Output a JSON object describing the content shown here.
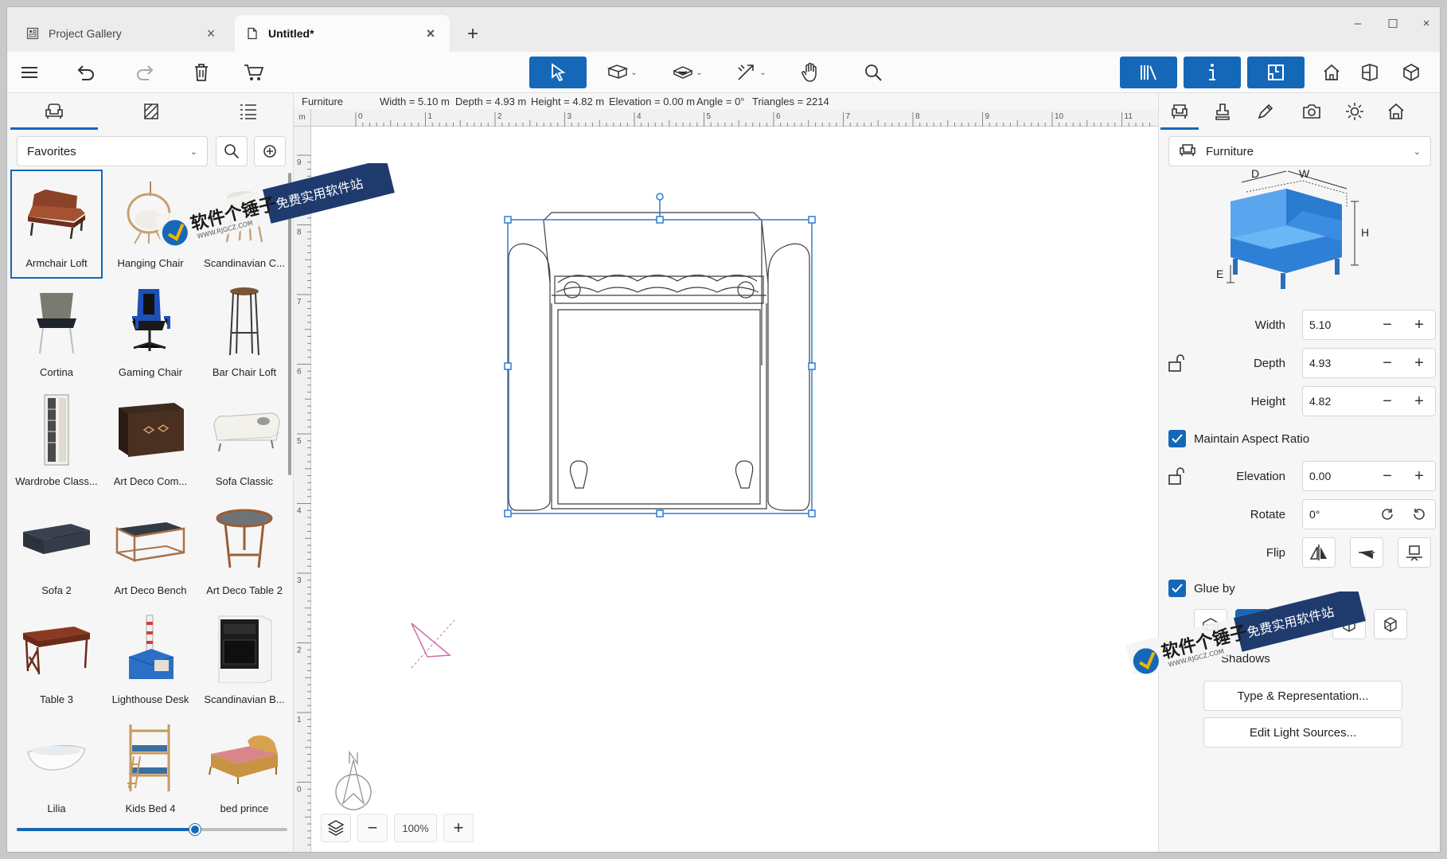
{
  "tabs": [
    {
      "label": "Project Gallery",
      "close": "×"
    },
    {
      "label": "Untitled*",
      "close": "×"
    }
  ],
  "tab_add": "+",
  "window_controls": {
    "minimize": "–",
    "maximize": "☐",
    "close": "×"
  },
  "toolbar": {
    "menu_icon": "hamburger-menu-icon",
    "undo_icon": "undo-icon",
    "redo_icon": "redo-icon",
    "delete_icon": "trash-icon",
    "cart_icon": "cart-icon",
    "select_icon": "pointer-icon",
    "search_icon": "search-icon",
    "accent_color": "#1568b8"
  },
  "left_panel": {
    "tabs": [
      "furniture-icon",
      "materials-icon",
      "list-icon"
    ],
    "filter": {
      "selected": "Favorites"
    },
    "items": [
      {
        "name": "Armchair Loft"
      },
      {
        "name": "Hanging Chair"
      },
      {
        "name": "Scandinavian C..."
      },
      {
        "name": "Cortina"
      },
      {
        "name": "Gaming Chair"
      },
      {
        "name": "Bar Chair Loft"
      },
      {
        "name": "Wardrobe Class..."
      },
      {
        "name": "Art Deco Com..."
      },
      {
        "name": "Sofa Classic"
      },
      {
        "name": "Sofa 2"
      },
      {
        "name": "Art Deco Bench"
      },
      {
        "name": "Art Deco Table 2"
      },
      {
        "name": "Table 3"
      },
      {
        "name": "Lighthouse Desk"
      },
      {
        "name": "Scandinavian B..."
      },
      {
        "name": "Lilia"
      },
      {
        "name": "Kids Bed 4"
      },
      {
        "name": "bed prince"
      }
    ],
    "thumbnail_size_fraction": 0.66
  },
  "infobar": {
    "category": "Furniture",
    "width": "Width = 5.10 m",
    "depth": "Depth = 4.93 m",
    "height": "Height = 4.82 m",
    "elevation": "Elevation = 0.00 m",
    "angle": "Angle = 0°",
    "triangles": "Triangles = 2214"
  },
  "ruler": {
    "unit": "m",
    "top_ticks": [
      "0",
      "1",
      "2",
      "3",
      "4",
      "5",
      "6",
      "7",
      "8",
      "9",
      "10",
      "11"
    ],
    "left_ticks": [
      "9",
      "8",
      "7",
      "6",
      "5",
      "4",
      "3",
      "2",
      "1",
      "0"
    ]
  },
  "zoom": {
    "value": "100%",
    "minus": "−",
    "plus": "+"
  },
  "right_panel": {
    "category": "Furniture",
    "dim_labels": {
      "d": "D",
      "w": "W",
      "h": "H",
      "e": "E"
    },
    "width": {
      "label": "Width",
      "value": "5.10"
    },
    "depth": {
      "label": "Depth",
      "value": "4.93"
    },
    "height": {
      "label": "Height",
      "value": "4.82"
    },
    "maintain_aspect": {
      "label": "Maintain Aspect Ratio",
      "checked": true
    },
    "elevation": {
      "label": "Elevation",
      "value": "0.00"
    },
    "rotate": {
      "label": "Rotate",
      "value": "0°"
    },
    "flip": {
      "label": "Flip"
    },
    "glue_by": {
      "label": "Glue by",
      "checked": true
    },
    "shadows": {
      "label": "Shadows"
    },
    "type_button": "Type & Representation...",
    "light_button": "Edit Light Sources..."
  },
  "watermark": {
    "brand": "软件个锤子",
    "slogan": "免费实用软件站",
    "url": "WWW.RJGCZ.COM"
  }
}
